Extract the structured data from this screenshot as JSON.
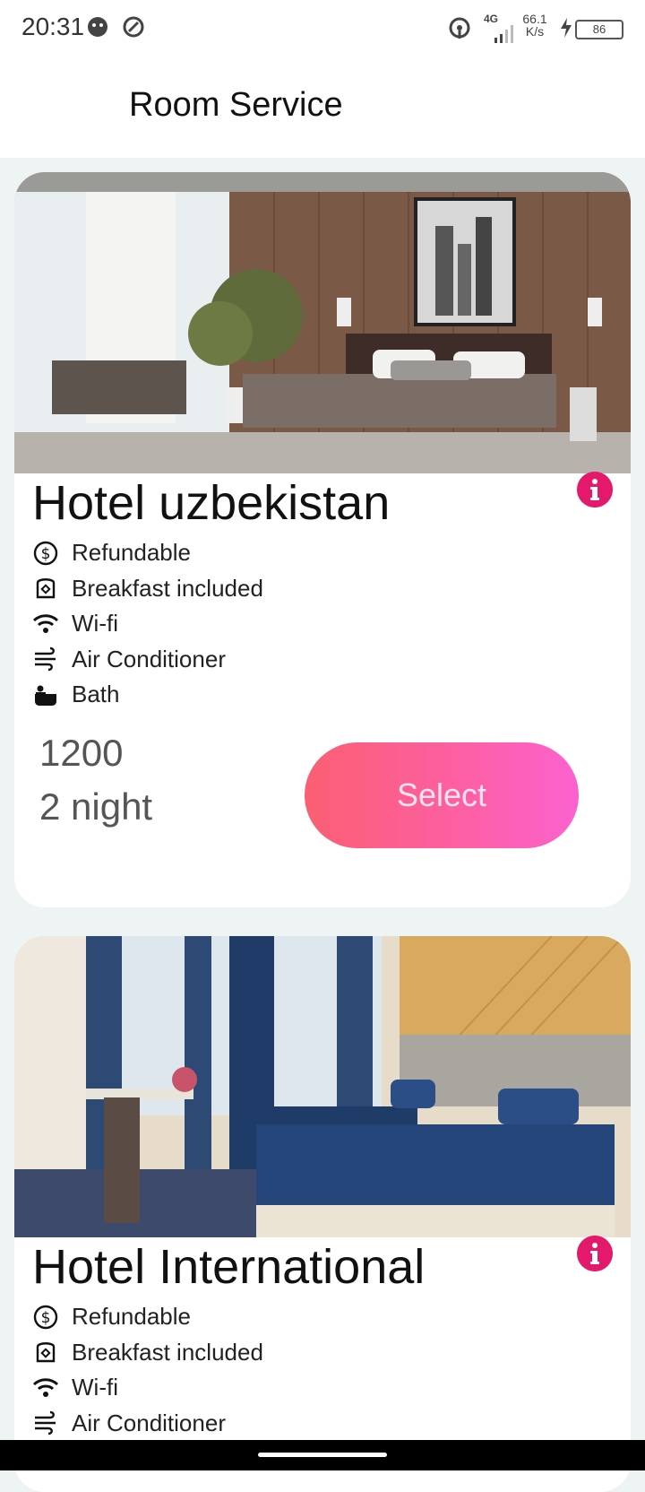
{
  "status_bar": {
    "time": "20:31",
    "network": "4G",
    "speed_value": "66.1",
    "speed_unit": "K/s",
    "battery": "86"
  },
  "app_bar": {
    "title": "Room Service"
  },
  "hotels": [
    {
      "name": "Hotel uzbekistan",
      "amenities": [
        {
          "icon": "dollar-icon",
          "label": "Refundable"
        },
        {
          "icon": "breakfast-icon",
          "label": "Breakfast included"
        },
        {
          "icon": "wifi-icon",
          "label": "Wi-fi"
        },
        {
          "icon": "air-conditioner-icon",
          "label": "Air Conditioner"
        },
        {
          "icon": "bath-icon",
          "label": "Bath"
        }
      ],
      "price": "1200",
      "nights": "2 night",
      "select_label": "Select"
    },
    {
      "name": "Hotel International",
      "amenities": [
        {
          "icon": "dollar-icon",
          "label": "Refundable"
        },
        {
          "icon": "breakfast-icon",
          "label": "Breakfast included"
        },
        {
          "icon": "wifi-icon",
          "label": "Wi-fi"
        },
        {
          "icon": "air-conditioner-icon",
          "label": "Air Conditioner"
        }
      ]
    }
  ],
  "colors": {
    "accent": "#e5196c",
    "button_start": "#fb5f72",
    "button_end": "#fb62cf"
  }
}
